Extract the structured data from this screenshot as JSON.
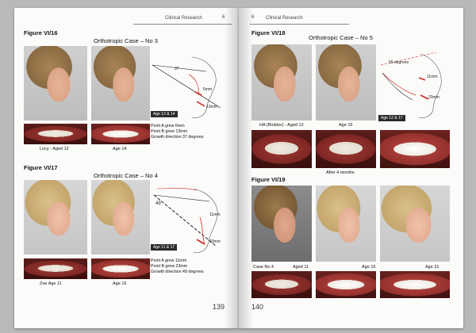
{
  "left_page": {
    "running_head": "Clinical Research",
    "header_page_number": "6",
    "page_number": "139",
    "fig16": {
      "label": "Figure VI/16",
      "case_title": "Orthotropic Case – No 3",
      "tracing_angle": "37",
      "tracing_a": "6mm",
      "tracing_b": "13mm",
      "age_badge": "Age 12 & 14",
      "caption_1": "Lucy - Aged 12",
      "caption_2": "Age 14",
      "notes": [
        "Point A grew 6mm",
        "Point B grew 13mm",
        "Growth direction 37 degrees"
      ]
    },
    "fig17": {
      "label": "Figure VI/17",
      "case_title": "Orthotropic Case – No 4",
      "tracing_angle": "49",
      "tracing_a": "11mm",
      "tracing_b": "23mm",
      "age_badge": "Age 11 & 17",
      "caption_1": "Zoe Age 11",
      "caption_2": "Age 16",
      "notes": [
        "Point A grew 11mm",
        "Point B grew 23mm",
        "Growth direction 49 degrees"
      ]
    }
  },
  "right_page": {
    "running_head": "Clinical Research",
    "header_page_number": "6",
    "page_number": "140",
    "fig18": {
      "label": "Figure VI/18",
      "case_title": "Orthotropic Case – No 5",
      "tracing_angle": "55 degrees",
      "tracing_a": "11mm",
      "tracing_b": "23mm",
      "age_badge": "Age 12 & 17",
      "caption_1": "HA (Biobloc) - Aged 12",
      "caption_2": "Age 16",
      "caption_3": "After 4 months"
    },
    "fig19": {
      "label": "Figure VI/19",
      "caption_case": "Case No 4",
      "caption_1": "Aged 11",
      "caption_2": "Age 16",
      "caption_3": "Age 31"
    }
  },
  "colors": {
    "tracing_red": "#d42a2a",
    "tracing_black": "#222222",
    "page": "#fbfbf9",
    "background": "#b9b9b9"
  }
}
